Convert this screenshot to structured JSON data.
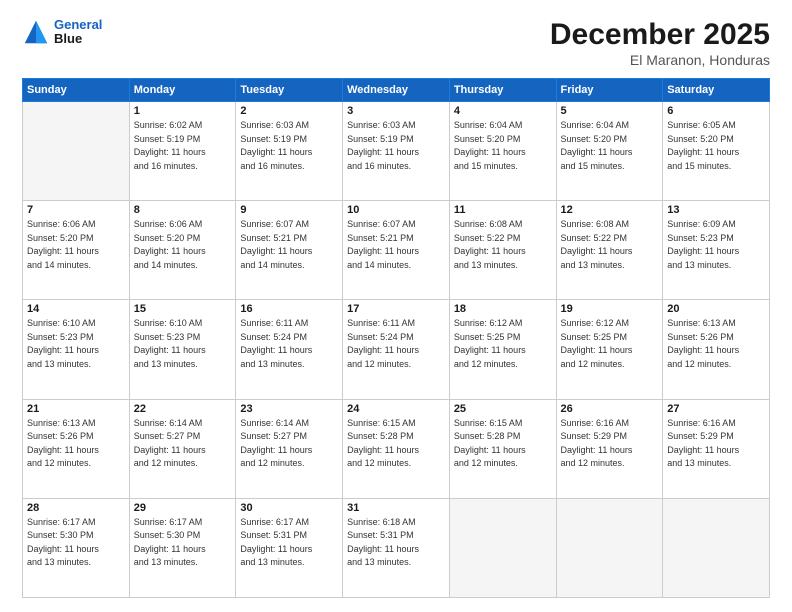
{
  "logo": {
    "text_general": "General",
    "text_blue": "Blue"
  },
  "header": {
    "month": "December 2025",
    "location": "El Maranon, Honduras"
  },
  "weekdays": [
    "Sunday",
    "Monday",
    "Tuesday",
    "Wednesday",
    "Thursday",
    "Friday",
    "Saturday"
  ],
  "weeks": [
    [
      {
        "day": "",
        "info": ""
      },
      {
        "day": "1",
        "info": "Sunrise: 6:02 AM\nSunset: 5:19 PM\nDaylight: 11 hours\nand 16 minutes."
      },
      {
        "day": "2",
        "info": "Sunrise: 6:03 AM\nSunset: 5:19 PM\nDaylight: 11 hours\nand 16 minutes."
      },
      {
        "day": "3",
        "info": "Sunrise: 6:03 AM\nSunset: 5:19 PM\nDaylight: 11 hours\nand 16 minutes."
      },
      {
        "day": "4",
        "info": "Sunrise: 6:04 AM\nSunset: 5:20 PM\nDaylight: 11 hours\nand 15 minutes."
      },
      {
        "day": "5",
        "info": "Sunrise: 6:04 AM\nSunset: 5:20 PM\nDaylight: 11 hours\nand 15 minutes."
      },
      {
        "day": "6",
        "info": "Sunrise: 6:05 AM\nSunset: 5:20 PM\nDaylight: 11 hours\nand 15 minutes."
      }
    ],
    [
      {
        "day": "7",
        "info": "Sunrise: 6:06 AM\nSunset: 5:20 PM\nDaylight: 11 hours\nand 14 minutes."
      },
      {
        "day": "8",
        "info": "Sunrise: 6:06 AM\nSunset: 5:20 PM\nDaylight: 11 hours\nand 14 minutes."
      },
      {
        "day": "9",
        "info": "Sunrise: 6:07 AM\nSunset: 5:21 PM\nDaylight: 11 hours\nand 14 minutes."
      },
      {
        "day": "10",
        "info": "Sunrise: 6:07 AM\nSunset: 5:21 PM\nDaylight: 11 hours\nand 14 minutes."
      },
      {
        "day": "11",
        "info": "Sunrise: 6:08 AM\nSunset: 5:22 PM\nDaylight: 11 hours\nand 13 minutes."
      },
      {
        "day": "12",
        "info": "Sunrise: 6:08 AM\nSunset: 5:22 PM\nDaylight: 11 hours\nand 13 minutes."
      },
      {
        "day": "13",
        "info": "Sunrise: 6:09 AM\nSunset: 5:23 PM\nDaylight: 11 hours\nand 13 minutes."
      }
    ],
    [
      {
        "day": "14",
        "info": "Sunrise: 6:10 AM\nSunset: 5:23 PM\nDaylight: 11 hours\nand 13 minutes."
      },
      {
        "day": "15",
        "info": "Sunrise: 6:10 AM\nSunset: 5:23 PM\nDaylight: 11 hours\nand 13 minutes."
      },
      {
        "day": "16",
        "info": "Sunrise: 6:11 AM\nSunset: 5:24 PM\nDaylight: 11 hours\nand 13 minutes."
      },
      {
        "day": "17",
        "info": "Sunrise: 6:11 AM\nSunset: 5:24 PM\nDaylight: 11 hours\nand 12 minutes."
      },
      {
        "day": "18",
        "info": "Sunrise: 6:12 AM\nSunset: 5:25 PM\nDaylight: 11 hours\nand 12 minutes."
      },
      {
        "day": "19",
        "info": "Sunrise: 6:12 AM\nSunset: 5:25 PM\nDaylight: 11 hours\nand 12 minutes."
      },
      {
        "day": "20",
        "info": "Sunrise: 6:13 AM\nSunset: 5:26 PM\nDaylight: 11 hours\nand 12 minutes."
      }
    ],
    [
      {
        "day": "21",
        "info": "Sunrise: 6:13 AM\nSunset: 5:26 PM\nDaylight: 11 hours\nand 12 minutes."
      },
      {
        "day": "22",
        "info": "Sunrise: 6:14 AM\nSunset: 5:27 PM\nDaylight: 11 hours\nand 12 minutes."
      },
      {
        "day": "23",
        "info": "Sunrise: 6:14 AM\nSunset: 5:27 PM\nDaylight: 11 hours\nand 12 minutes."
      },
      {
        "day": "24",
        "info": "Sunrise: 6:15 AM\nSunset: 5:28 PM\nDaylight: 11 hours\nand 12 minutes."
      },
      {
        "day": "25",
        "info": "Sunrise: 6:15 AM\nSunset: 5:28 PM\nDaylight: 11 hours\nand 12 minutes."
      },
      {
        "day": "26",
        "info": "Sunrise: 6:16 AM\nSunset: 5:29 PM\nDaylight: 11 hours\nand 12 minutes."
      },
      {
        "day": "27",
        "info": "Sunrise: 6:16 AM\nSunset: 5:29 PM\nDaylight: 11 hours\nand 13 minutes."
      }
    ],
    [
      {
        "day": "28",
        "info": "Sunrise: 6:17 AM\nSunset: 5:30 PM\nDaylight: 11 hours\nand 13 minutes."
      },
      {
        "day": "29",
        "info": "Sunrise: 6:17 AM\nSunset: 5:30 PM\nDaylight: 11 hours\nand 13 minutes."
      },
      {
        "day": "30",
        "info": "Sunrise: 6:17 AM\nSunset: 5:31 PM\nDaylight: 11 hours\nand 13 minutes."
      },
      {
        "day": "31",
        "info": "Sunrise: 6:18 AM\nSunset: 5:31 PM\nDaylight: 11 hours\nand 13 minutes."
      },
      {
        "day": "",
        "info": ""
      },
      {
        "day": "",
        "info": ""
      },
      {
        "day": "",
        "info": ""
      }
    ]
  ]
}
